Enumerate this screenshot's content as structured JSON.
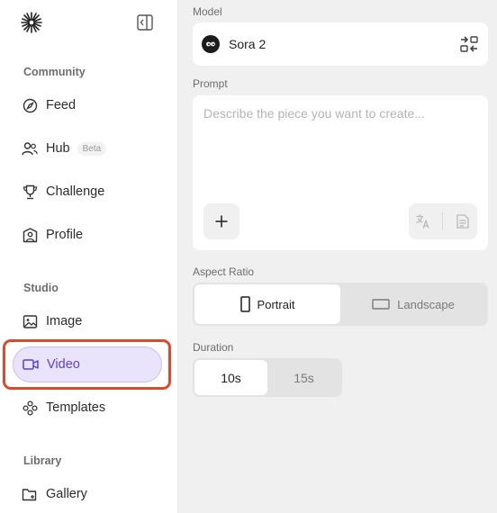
{
  "sidebar": {
    "sections": [
      {
        "label": "Community"
      },
      {
        "label": "Studio"
      },
      {
        "label": "Library"
      }
    ],
    "items": [
      {
        "label": "Feed",
        "icon": "compass-icon"
      },
      {
        "label": "Hub",
        "icon": "people-icon",
        "badge": "Beta"
      },
      {
        "label": "Challenge",
        "icon": "trophy-icon"
      },
      {
        "label": "Profile",
        "icon": "profile-icon"
      },
      {
        "label": "Image",
        "icon": "image-icon"
      },
      {
        "label": "Video",
        "icon": "video-icon",
        "active": true
      },
      {
        "label": "Templates",
        "icon": "templates-icon"
      },
      {
        "label": "Gallery",
        "icon": "folder-icon"
      }
    ]
  },
  "model": {
    "label": "Model",
    "name": "Sora 2"
  },
  "prompt": {
    "label": "Prompt",
    "placeholder": "Describe the piece you want to create..."
  },
  "aspect_ratio": {
    "label": "Aspect Ratio",
    "options": [
      "Portrait",
      "Landscape"
    ],
    "selected": "Portrait"
  },
  "duration": {
    "label": "Duration",
    "options": [
      "10s",
      "15s"
    ],
    "selected": "10s"
  },
  "colors": {
    "accent": "#5b3fd6",
    "active_bg": "#e9e3fb",
    "highlight": "#d94a2f"
  }
}
